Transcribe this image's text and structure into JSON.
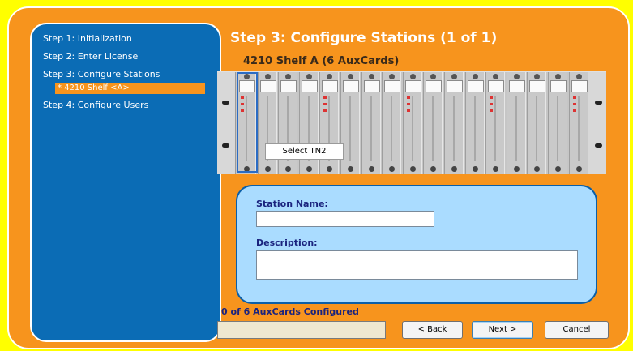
{
  "sidebar": {
    "steps": [
      {
        "label": "Step 1: Initialization"
      },
      {
        "label": "Step 2: Enter License"
      },
      {
        "label": "Step 3: Configure Stations"
      },
      {
        "label": "Step 4: Configure Users"
      }
    ],
    "active_sub_item": "* 4210 Shelf <A>"
  },
  "main": {
    "title": "Step 3: Configure Stations (1 of 1)",
    "shelf_title": "4210 Shelf A (6 AuxCards)",
    "select_button": "Select TN2"
  },
  "form": {
    "station_name_label": "Station Name:",
    "station_name_value": "",
    "description_label": "Description:",
    "description_value": ""
  },
  "footer": {
    "status": "0 of 6 AuxCards Configured",
    "progress": 0,
    "back_label": "< Back",
    "next_label": "Next >",
    "cancel_label": "Cancel"
  },
  "colors": {
    "background": "#ffff00",
    "frame": "#f7941d",
    "sidebar": "#0b6cb5",
    "form_panel": "#aadcff"
  }
}
